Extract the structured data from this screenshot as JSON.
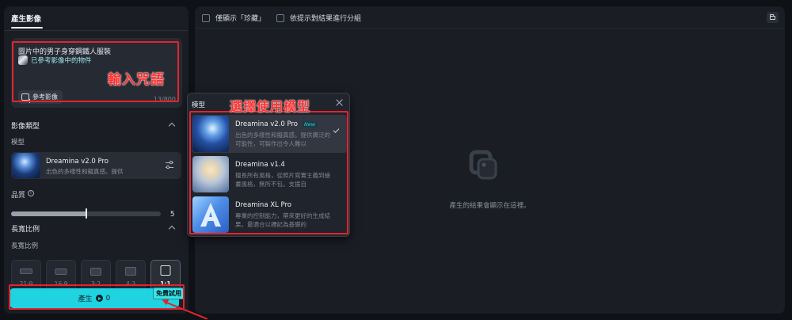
{
  "left_panel": {
    "tab_label": "產生影像",
    "prompt": {
      "text": "圖片中的男子身穿鋼鐵人服裝",
      "reference_chip": "已參考影像中的物件",
      "reference_button": "參考影像",
      "char_count": "13/800"
    },
    "image_type_section": {
      "title": "影像類型",
      "model_label": "模型",
      "model_name": "Dreamina v2.0 Pro",
      "model_desc": "出色的多樣性和擬真感。提供",
      "quality_label": "品質",
      "quality_value": "5",
      "quality_fraction": 0.5
    },
    "aspect_section": {
      "title": "長寬比例",
      "subtitle": "長寬比例",
      "ratios": [
        {
          "label": "21:9"
        },
        {
          "label": "16:9"
        },
        {
          "label": "3:2"
        },
        {
          "label": "4:3"
        },
        {
          "label": "1:1"
        }
      ]
    },
    "generate_button": {
      "label": "產生",
      "cost": "0",
      "badge": "免費試用"
    }
  },
  "main_panel": {
    "filter_favorites": "僅顯示「珍藏」",
    "filter_group": "依提示對結果進行分組",
    "empty_text": "產生的結果會顯示在這裡。"
  },
  "model_popup": {
    "title": "模型",
    "items": [
      {
        "name": "Dreamina v2.0 Pro",
        "badge": "New",
        "desc": "出色的多樣性和擬真感。提供廣泛的可能性，可製作出令人難以"
      },
      {
        "name": "Dreamina v1.4",
        "badge": "",
        "desc": "擅長所有風格，從照片寫實主義到繪畫風格，無所不包。支援自"
      },
      {
        "name": "Dreamina XL Pro",
        "badge": "",
        "desc": "專業的控制能力，帶來更好的生成結果。最適合以標記為基礎的"
      }
    ]
  },
  "annotations": {
    "prompt_label": "輸入咒語",
    "model_label": "選擇使用模型"
  },
  "colors": {
    "accent": "#1fd3e0",
    "annotation": "#e0252d",
    "panel_bg": "#1a1d24",
    "page_bg": "#0e1116"
  }
}
